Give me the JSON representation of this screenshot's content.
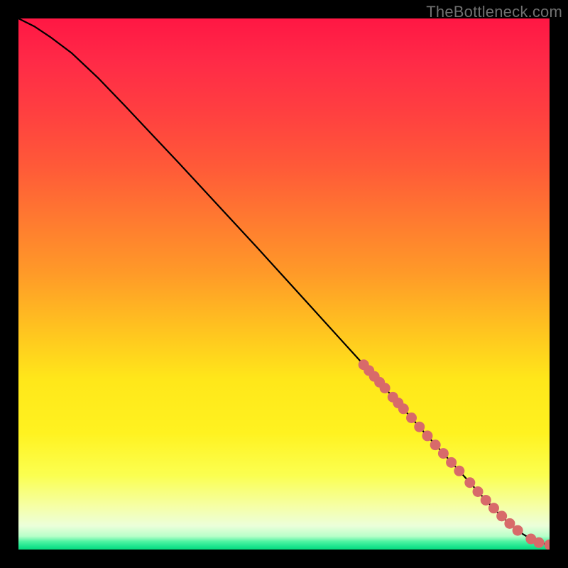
{
  "watermark": "TheBottleneck.com",
  "accent_line_color": "#000000",
  "marker_color": "#d86a6a",
  "gradient_stops": [
    {
      "offset": 0.0,
      "color": "#ff1744"
    },
    {
      "offset": 0.08,
      "color": "#ff2a47"
    },
    {
      "offset": 0.18,
      "color": "#ff4040"
    },
    {
      "offset": 0.28,
      "color": "#ff5a38"
    },
    {
      "offset": 0.38,
      "color": "#ff7a30"
    },
    {
      "offset": 0.48,
      "color": "#ff9a28"
    },
    {
      "offset": 0.58,
      "color": "#ffc120"
    },
    {
      "offset": 0.68,
      "color": "#ffe71a"
    },
    {
      "offset": 0.78,
      "color": "#fff220"
    },
    {
      "offset": 0.86,
      "color": "#fbff50"
    },
    {
      "offset": 0.92,
      "color": "#f5ffa8"
    },
    {
      "offset": 0.955,
      "color": "#ecffda"
    },
    {
      "offset": 0.975,
      "color": "#b7ffc9"
    },
    {
      "offset": 0.985,
      "color": "#4df3a2"
    },
    {
      "offset": 0.995,
      "color": "#17e38c"
    },
    {
      "offset": 1.0,
      "color": "#08d97e"
    }
  ],
  "chart_data": {
    "type": "line",
    "title": "",
    "xlabel": "",
    "ylabel": "",
    "xlim": [
      0,
      100
    ],
    "ylim": [
      0,
      100
    ],
    "series": [
      {
        "name": "curve",
        "x": [
          0,
          3,
          6,
          10,
          15,
          20,
          25,
          30,
          35,
          40,
          45,
          50,
          55,
          60,
          65,
          68,
          70,
          72,
          74,
          76,
          78,
          80,
          82,
          84,
          86,
          88,
          90,
          92,
          94,
          95,
          96,
          97,
          98,
          99,
          100
        ],
        "values": [
          100,
          98.5,
          96.5,
          93.5,
          88.8,
          83.6,
          78.3,
          73.0,
          67.6,
          62.2,
          56.8,
          51.3,
          45.8,
          40.3,
          34.8,
          31.5,
          29.3,
          27.0,
          24.8,
          22.5,
          20.3,
          18.1,
          15.9,
          13.7,
          11.5,
          9.3,
          7.2,
          5.3,
          3.6,
          2.9,
          2.3,
          1.8,
          1.4,
          1.1,
          0.9
        ]
      }
    ],
    "markers": [
      {
        "x": 65.0,
        "y": 34.8
      },
      {
        "x": 66.0,
        "y": 33.7
      },
      {
        "x": 67.0,
        "y": 32.6
      },
      {
        "x": 68.0,
        "y": 31.5
      },
      {
        "x": 69.0,
        "y": 30.4
      },
      {
        "x": 70.5,
        "y": 28.7
      },
      {
        "x": 71.5,
        "y": 27.6
      },
      {
        "x": 72.5,
        "y": 26.5
      },
      {
        "x": 74.0,
        "y": 24.8
      },
      {
        "x": 75.5,
        "y": 23.1
      },
      {
        "x": 77.0,
        "y": 21.4
      },
      {
        "x": 78.5,
        "y": 19.7
      },
      {
        "x": 80.0,
        "y": 18.1
      },
      {
        "x": 81.5,
        "y": 16.4
      },
      {
        "x": 83.0,
        "y": 14.8
      },
      {
        "x": 85.0,
        "y": 12.6
      },
      {
        "x": 86.5,
        "y": 10.9
      },
      {
        "x": 88.0,
        "y": 9.3
      },
      {
        "x": 89.5,
        "y": 7.8
      },
      {
        "x": 91.0,
        "y": 6.3
      },
      {
        "x": 92.5,
        "y": 4.9
      },
      {
        "x": 94.0,
        "y": 3.6
      },
      {
        "x": 96.5,
        "y": 2.0
      },
      {
        "x": 98.0,
        "y": 1.3
      },
      {
        "x": 100.0,
        "y": 0.9
      }
    ]
  }
}
